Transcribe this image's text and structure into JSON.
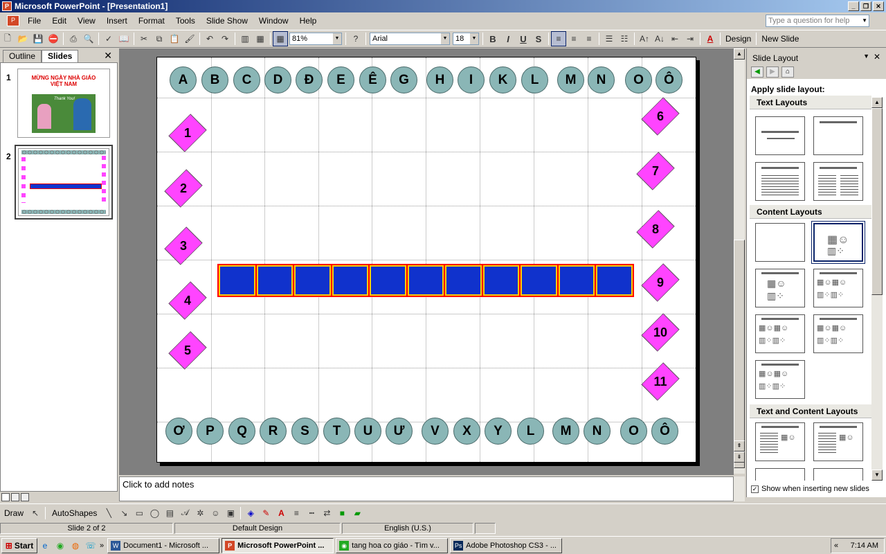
{
  "window": {
    "title": "Microsoft PowerPoint - [Presentation1]"
  },
  "menu": [
    "File",
    "Edit",
    "View",
    "Insert",
    "Format",
    "Tools",
    "Slide Show",
    "Window",
    "Help"
  ],
  "help_placeholder": "Type a question for help",
  "toolbar": {
    "zoom": "81%",
    "font": "Arial",
    "size": "18",
    "design_label": "Design",
    "new_slide_label": "New Slide"
  },
  "panel": {
    "tab_outline": "Outline",
    "tab_slides": "Slides"
  },
  "thumbnails": [
    {
      "num": "1",
      "title": "MỪNG NGÀY NHÀ GIÁO VIỆT NAM",
      "caption": "Thank You!"
    },
    {
      "num": "2"
    }
  ],
  "slide": {
    "top_letters": [
      "A",
      "B",
      "C",
      "D",
      "Đ",
      "E",
      "Ê",
      "G",
      "H",
      "I",
      "K",
      "L",
      "M",
      "N",
      "O",
      "Ô"
    ],
    "bottom_letters": [
      "Ơ",
      "P",
      "Q",
      "R",
      "S",
      "T",
      "U",
      "Ư",
      "V",
      "X",
      "Y",
      "L",
      "M",
      "N",
      "O",
      "Ô"
    ],
    "left_numbers": [
      "1",
      "2",
      "3",
      "4",
      "5"
    ],
    "right_numbers": [
      "6",
      "7",
      "8",
      "9",
      "10",
      "11"
    ],
    "box_count": 11
  },
  "notes": "Click to add notes",
  "taskpane": {
    "title": "Slide Layout",
    "apply_label": "Apply slide layout:",
    "groups": [
      "Text Layouts",
      "Content Layouts",
      "Text and Content Layouts"
    ],
    "show_label": "Show when inserting new slides"
  },
  "drawing": {
    "draw": "Draw",
    "autoshapes": "AutoShapes"
  },
  "status": {
    "slide": "Slide 2 of 2",
    "design": "Default Design",
    "lang": "English (U.S.)"
  },
  "taskbar": {
    "start": "Start",
    "tasks": [
      "Document1 - Microsoft ...",
      "Microsoft PowerPoint ...",
      "tang hoa co giáo - Tìm v...",
      "Adobe Photoshop CS3 - ..."
    ],
    "time": "7:14 AM"
  }
}
